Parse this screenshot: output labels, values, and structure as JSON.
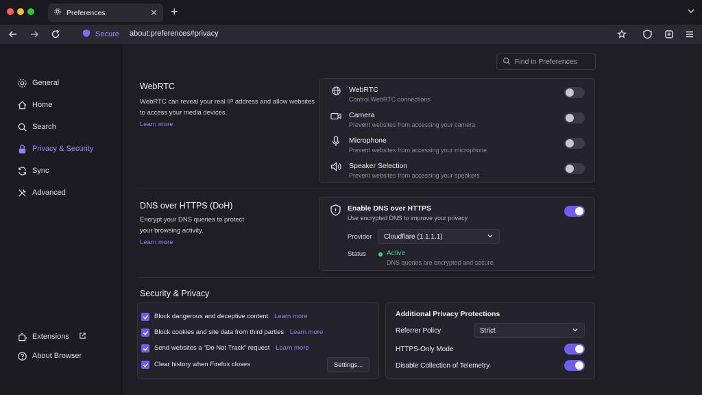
{
  "window": {
    "tab_title": "Preferences",
    "tab_close": "✕",
    "new_tab": "+"
  },
  "colors": {
    "accent": "#6e5ef0",
    "link": "#8f84f5",
    "status_active": "#3fcf7a",
    "close": "#ff5f57",
    "minimize": "#febc2e",
    "maximize": "#28c840"
  },
  "navbar": {
    "secure_label": "Secure",
    "url": "about:preferences#privacy"
  },
  "sidebar": {
    "items": [
      {
        "label": "General",
        "icon": "gear-icon"
      },
      {
        "label": "Home",
        "icon": "home-icon"
      },
      {
        "label": "Search",
        "icon": "search-icon"
      },
      {
        "label": "Privacy & Security",
        "icon": "lock-icon"
      },
      {
        "label": "Sync",
        "icon": "sync-icon"
      },
      {
        "label": "Advanced",
        "icon": "tools-icon"
      }
    ],
    "extensions_label": "Extensions",
    "about_label": "About Browser"
  },
  "search": {
    "placeholder": "Find in Preferences"
  },
  "webrtc": {
    "title": "WebRTC",
    "desc_line1": "WebRTC can reveal your real IP address and allow websites",
    "desc_line2": "to access your media devices.",
    "learn_more": "Learn more",
    "rows": [
      {
        "title": "WebRTC",
        "sub": "Control WebRTC connections",
        "icon": "globe-icon",
        "enabled": false
      },
      {
        "title": "Camera",
        "sub": "Prevent websites from accessing your camera",
        "icon": "camera-icon",
        "enabled": false
      },
      {
        "title": "Microphone",
        "sub": "Prevent websites from accessing your microphone",
        "icon": "microphone-icon",
        "enabled": false
      },
      {
        "title": "Speaker Selection",
        "sub": "Prevent websites from accessing your speakers",
        "icon": "speaker-icon",
        "enabled": false
      }
    ]
  },
  "doh": {
    "title": "DNS over HTTPS (DoH)",
    "desc_line1": "Encrypt your DNS queries to protect",
    "desc_line2": "your browsing activity.",
    "learn_more": "Learn more",
    "enable_title": "Enable DNS over HTTPS",
    "enable_sub": "Use encrypted DNS to improve your privacy",
    "enabled": true,
    "provider_label": "Provider",
    "provider_value": "Cloudflare (1.1.1.1)",
    "status_label": "Status",
    "status_value": "Active",
    "status_sub": "DNS queries are encrypted and secure."
  },
  "security": {
    "title": "Security & Privacy",
    "checks": [
      {
        "label": "Block dangerous and deceptive content",
        "learn": "Learn more",
        "checked": true
      },
      {
        "label": "Block cookies and site data from third parties",
        "learn": "Learn more",
        "checked": true
      },
      {
        "label": "Send websites a “Do Not Track” request",
        "learn": "Learn more",
        "checked": true
      },
      {
        "label": "Clear history when Firefox closes",
        "learn": "",
        "checked": true
      }
    ],
    "settings_button": "Settings...",
    "additional": {
      "title": "Additional Privacy Protections",
      "referrer_label": "Referrer Policy",
      "referrer_value": "Strict",
      "https_only_label": "HTTPS-Only Mode",
      "https_only_enabled": true,
      "telemetry_label": "Disable Collection of Telemetry",
      "telemetry_enabled": true
    }
  }
}
